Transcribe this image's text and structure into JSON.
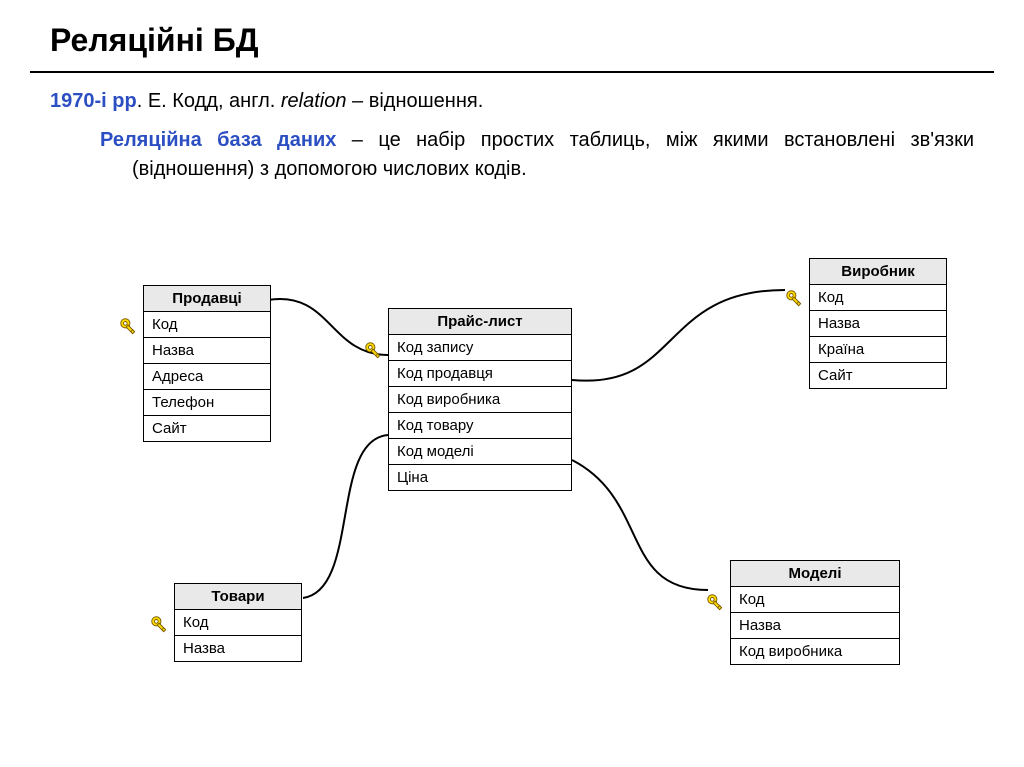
{
  "title": "Реляційні БД",
  "line1": {
    "prefix": "1970-і рр",
    "rest": ". Е. Кодд, англ. ",
    "italic": "relation",
    "tail": " – відношення."
  },
  "line2": {
    "prefix": "Реляційна база даних",
    "rest": " – це набір простих таблиць, між якими встановлені зв'язки (відношення) з допомогою числових кодів."
  },
  "entities": {
    "sellers": {
      "title": "Продавці",
      "fields": [
        "Код",
        "Назва",
        "Адреса",
        "Телефон",
        "Сайт"
      ]
    },
    "pricelist": {
      "title": "Прайс-лист",
      "fields": [
        "Код запису",
        "Код продавця",
        "Код виробника",
        "Код товару",
        "Код моделі",
        "Ціна"
      ]
    },
    "manufacturer": {
      "title": "Виробник",
      "fields": [
        "Код",
        "Назва",
        "Країна",
        "Сайт"
      ]
    },
    "goods": {
      "title": "Товари",
      "fields": [
        "Код",
        "Назва"
      ]
    },
    "models": {
      "title": "Моделі",
      "fields": [
        "Код",
        "Назва",
        "Код виробника"
      ]
    }
  }
}
